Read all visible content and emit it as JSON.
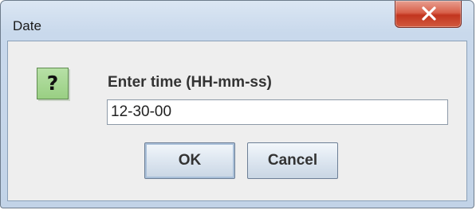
{
  "window": {
    "title": "Date"
  },
  "dialog": {
    "icon": "question-icon",
    "icon_glyph": "?",
    "prompt": "Enter time (HH-mm-ss)",
    "input_value": "12-30-00",
    "ok_label": "OK",
    "cancel_label": "Cancel"
  },
  "colors": {
    "close_button": "#d24a33",
    "icon_background": "#a6d690",
    "dialog_background": "#eeeeee",
    "frame": "#c9d9ec"
  }
}
